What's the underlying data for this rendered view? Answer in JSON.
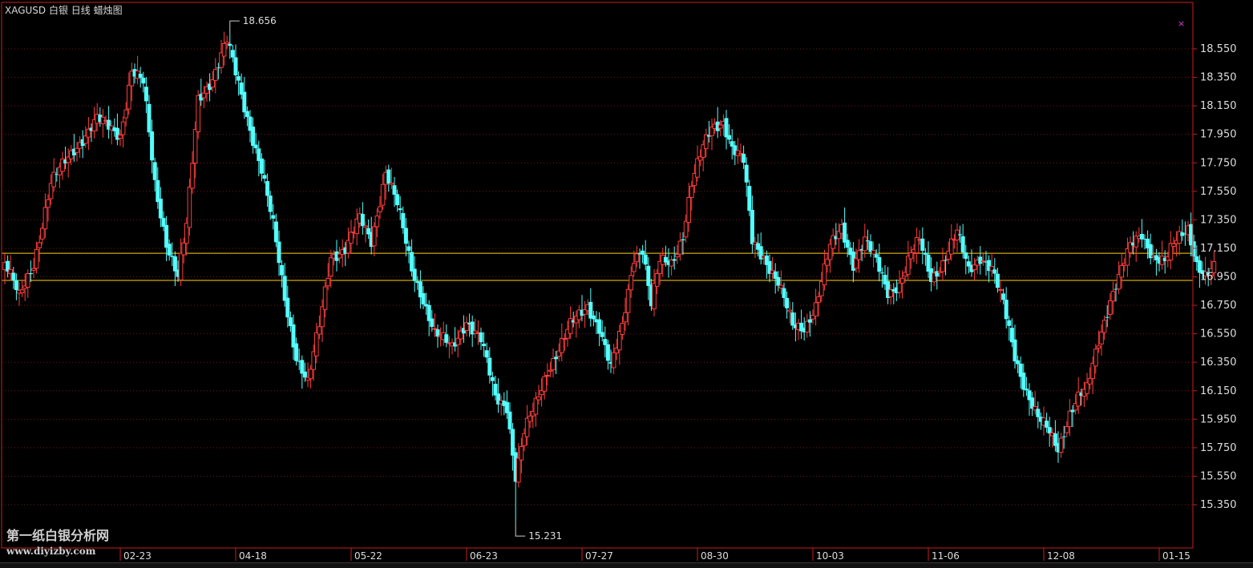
{
  "header": {
    "title": "XAGUSD 白银 日线 蜡烛图",
    "close_glyph": "×"
  },
  "watermark": {
    "line1": "第一纸白银分析网",
    "line2": "www.diyizby.com"
  },
  "colors": {
    "up": "#ff3c3c",
    "down": "#54ffff",
    "frame": "#c81e1e",
    "grid": "#7a1515",
    "hline": "#ffd000",
    "axis_text": "#dddddd"
  },
  "chart_data": {
    "type": "candlestick",
    "symbol": "XAGUSD",
    "period": "日线",
    "ylim": [
      15.2,
      18.78
    ],
    "y_ticks": [
      15.35,
      15.55,
      15.75,
      15.95,
      16.15,
      16.35,
      16.55,
      16.75,
      16.95,
      17.15,
      17.35,
      17.55,
      17.75,
      17.95,
      18.15,
      18.35,
      18.55
    ],
    "y_tick_labels": [
      "15.350",
      "15.550",
      "15.750",
      "15.950",
      "16.150",
      "16.350",
      "16.550",
      "16.750",
      "16.950",
      "17.150",
      "17.350",
      "17.550",
      "17.750",
      "17.950",
      "18.150",
      "18.350",
      "18.550"
    ],
    "x_date_labels": [
      {
        "label": "02-23",
        "index": 40
      },
      {
        "label": "04-18",
        "index": 80
      },
      {
        "label": "05-22",
        "index": 120
      },
      {
        "label": "06-23",
        "index": 160
      },
      {
        "label": "07-27",
        "index": 200
      },
      {
        "label": "08-30",
        "index": 240
      },
      {
        "label": "10-03",
        "index": 280
      },
      {
        "label": "11-06",
        "index": 320
      },
      {
        "label": "12-08",
        "index": 360
      },
      {
        "label": "01-15",
        "index": 400
      }
    ],
    "annotations": [
      {
        "label": "18.656",
        "value": 18.656,
        "index": 78
      },
      {
        "label": "15.231",
        "value": 15.231,
        "index": 177
      }
    ],
    "horizontal_lines": [
      17.115,
      16.925
    ],
    "anchors": [
      [
        0,
        17.05
      ],
      [
        5,
        16.8
      ],
      [
        10,
        17.05
      ],
      [
        16,
        17.6
      ],
      [
        24,
        17.85
      ],
      [
        32,
        18.05
      ],
      [
        40,
        17.95
      ],
      [
        44,
        18.4
      ],
      [
        48,
        18.3
      ],
      [
        52,
        17.6
      ],
      [
        56,
        17.2
      ],
      [
        60,
        16.95
      ],
      [
        63,
        17.3
      ],
      [
        67,
        18.2
      ],
      [
        72,
        18.35
      ],
      [
        77,
        18.6
      ],
      [
        81,
        18.3
      ],
      [
        85,
        18.0
      ],
      [
        89,
        17.7
      ],
      [
        93,
        17.3
      ],
      [
        97,
        16.8
      ],
      [
        101,
        16.4
      ],
      [
        105,
        16.2
      ],
      [
        109,
        16.6
      ],
      [
        113,
        17.1
      ],
      [
        118,
        17.15
      ],
      [
        123,
        17.35
      ],
      [
        127,
        17.2
      ],
      [
        132,
        17.7
      ],
      [
        136,
        17.45
      ],
      [
        141,
        17.0
      ],
      [
        145,
        16.8
      ],
      [
        149,
        16.55
      ],
      [
        155,
        16.45
      ],
      [
        160,
        16.65
      ],
      [
        165,
        16.5
      ],
      [
        170,
        16.1
      ],
      [
        174,
        16.05
      ],
      [
        177,
        15.55
      ],
      [
        180,
        15.85
      ],
      [
        184,
        16.05
      ],
      [
        188,
        16.3
      ],
      [
        192,
        16.45
      ],
      [
        196,
        16.6
      ],
      [
        202,
        16.75
      ],
      [
        206,
        16.6
      ],
      [
        210,
        16.3
      ],
      [
        214,
        16.6
      ],
      [
        218,
        17.1
      ],
      [
        221,
        17.15
      ],
      [
        224,
        16.75
      ],
      [
        227,
        17.05
      ],
      [
        231,
        17.05
      ],
      [
        235,
        17.25
      ],
      [
        238,
        17.6
      ],
      [
        242,
        17.85
      ],
      [
        245,
        18.0
      ],
      [
        249,
        18.05
      ],
      [
        252,
        17.85
      ],
      [
        256,
        17.75
      ],
      [
        259,
        17.2
      ],
      [
        263,
        17.1
      ],
      [
        268,
        16.9
      ],
      [
        273,
        16.6
      ],
      [
        277,
        16.6
      ],
      [
        281,
        16.75
      ],
      [
        286,
        17.15
      ],
      [
        290,
        17.3
      ],
      [
        294,
        17.05
      ],
      [
        298,
        17.2
      ],
      [
        302,
        17.05
      ],
      [
        306,
        16.85
      ],
      [
        310,
        16.9
      ],
      [
        314,
        17.1
      ],
      [
        317,
        17.2
      ],
      [
        321,
        16.95
      ],
      [
        325,
        17.05
      ],
      [
        330,
        17.25
      ],
      [
        334,
        17.0
      ],
      [
        338,
        17.1
      ],
      [
        342,
        17.0
      ],
      [
        346,
        16.75
      ],
      [
        350,
        16.4
      ],
      [
        354,
        16.15
      ],
      [
        358,
        15.95
      ],
      [
        362,
        15.85
      ],
      [
        365,
        15.75
      ],
      [
        369,
        16.0
      ],
      [
        372,
        16.1
      ],
      [
        375,
        16.15
      ],
      [
        379,
        16.5
      ],
      [
        383,
        16.8
      ],
      [
        386,
        16.95
      ],
      [
        390,
        17.15
      ],
      [
        394,
        17.25
      ],
      [
        398,
        17.1
      ],
      [
        402,
        17.05
      ],
      [
        406,
        17.2
      ],
      [
        410,
        17.3
      ],
      [
        413,
        17.05
      ],
      [
        416,
        16.95
      ],
      [
        419,
        17.0
      ]
    ]
  }
}
